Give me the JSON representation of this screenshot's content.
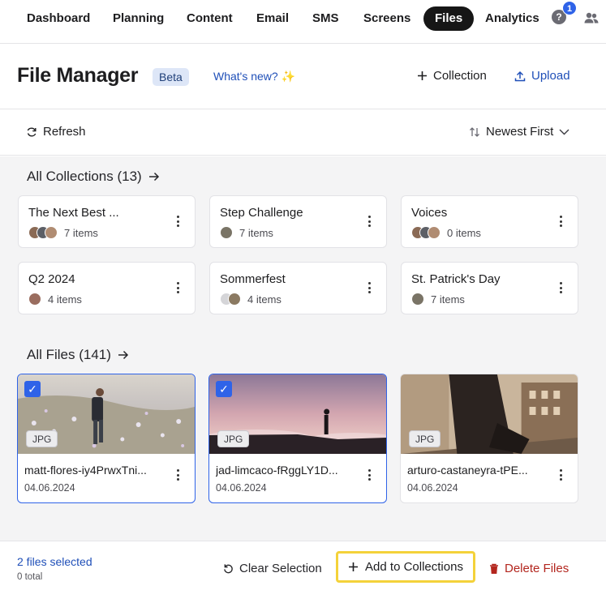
{
  "nav": {
    "items": [
      "Dashboard",
      "Planning",
      "Content",
      "Email",
      "SMS",
      "Screens",
      "Files",
      "Analytics"
    ],
    "active": "Files",
    "help_badge_count": "1",
    "help_icon": "?"
  },
  "header": {
    "title": "File Manager",
    "badge": "Beta",
    "whats_new": "What's new?",
    "sparkle": "✨",
    "collection_label": "Collection",
    "upload_label": "Upload"
  },
  "toolbar": {
    "refresh_label": "Refresh",
    "sort_label": "Newest First"
  },
  "collections": {
    "title": "All Collections (13)",
    "items": [
      {
        "name": "The Next Best ...",
        "count": "7 items"
      },
      {
        "name": "Step Challenge",
        "count": "7 items"
      },
      {
        "name": "Voices",
        "count": "0 items"
      },
      {
        "name": "Q2 2024",
        "count": "4 items"
      },
      {
        "name": "Sommerfest",
        "count": "4 items"
      },
      {
        "name": "St. Patrick's Day",
        "count": "7 items"
      }
    ]
  },
  "files": {
    "title": "All Files (141)",
    "items": [
      {
        "name": "matt-flores-iy4PrwxTni...",
        "date": "04.06.2024",
        "type": "JPG",
        "selected": true
      },
      {
        "name": "jad-limcaco-fRggLY1D...",
        "date": "04.06.2024",
        "type": "JPG",
        "selected": true
      },
      {
        "name": "arturo-castaneyra-tPE...",
        "date": "04.06.2024",
        "type": "JPG",
        "selected": false
      }
    ]
  },
  "footer": {
    "selected_label": "2 files selected",
    "total_label": "0 total",
    "clear_label": "Clear Selection",
    "add_label": "Add to Collections",
    "delete_label": "Delete Files"
  },
  "colors": {
    "accent": "#2f63e8",
    "link": "#1f4fb8",
    "danger": "#b3261e",
    "highlight": "#f4d23a"
  }
}
